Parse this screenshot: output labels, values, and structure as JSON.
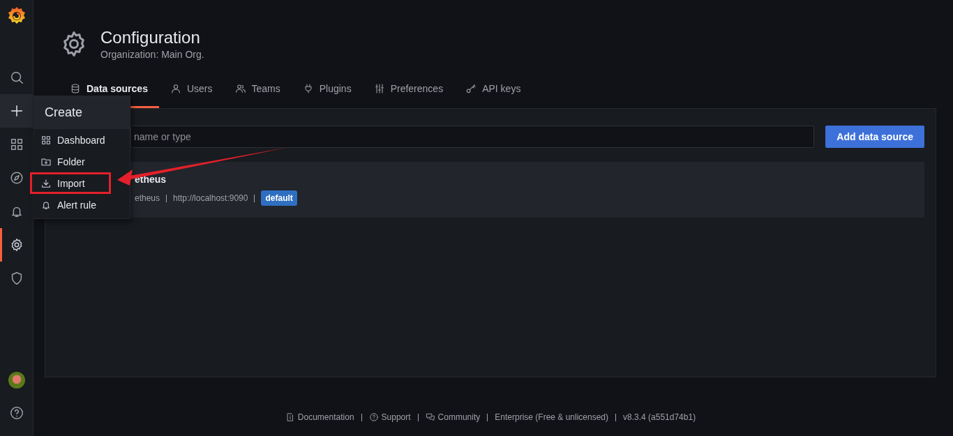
{
  "sidebar": {
    "items": [
      {
        "selected": false,
        "hovered": false
      },
      {
        "selected": false,
        "hovered": true
      },
      {
        "selected": false,
        "hovered": false
      },
      {
        "selected": false,
        "hovered": false
      },
      {
        "selected": false,
        "hovered": false
      },
      {
        "selected": true,
        "hovered": false
      },
      {
        "selected": false,
        "hovered": false
      }
    ]
  },
  "header": {
    "title": "Configuration",
    "subtitle": "Organization: Main Org."
  },
  "tabs": [
    {
      "label": "Data sources",
      "selected": true
    },
    {
      "label": "Users",
      "selected": false
    },
    {
      "label": "Teams",
      "selected": false
    },
    {
      "label": "Plugins",
      "selected": false
    },
    {
      "label": "Preferences",
      "selected": false
    },
    {
      "label": "API keys",
      "selected": false
    }
  ],
  "search": {
    "placeholder": "name or type"
  },
  "add_button": "Add data source",
  "datasources": [
    {
      "name": "etheus",
      "type": "etheus",
      "url": "http://localhost:9090",
      "badge": "default"
    }
  ],
  "create_menu": {
    "title": "Create",
    "items": [
      {
        "label": "Dashboard",
        "marked": false
      },
      {
        "label": "Folder",
        "marked": false
      },
      {
        "label": "Import",
        "marked": true
      },
      {
        "label": "Alert rule",
        "marked": false
      }
    ]
  },
  "footer": [
    "Documentation",
    "Support",
    "Community",
    "Enterprise (Free & unlicensed)",
    "v8.3.4 (a551d74b1)"
  ]
}
